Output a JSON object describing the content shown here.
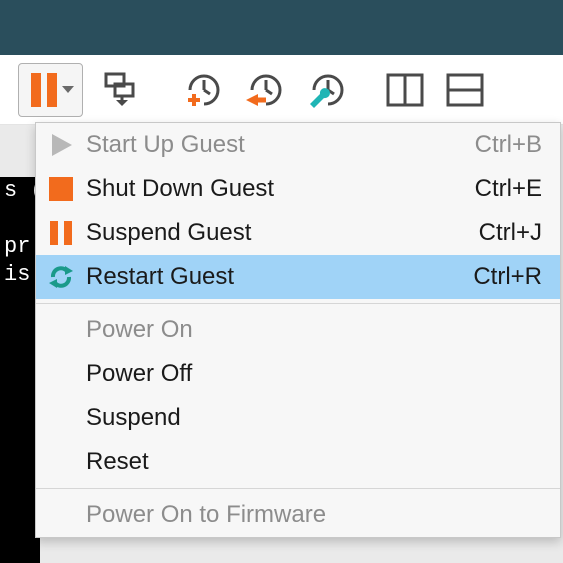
{
  "colors": {
    "accent_orange": "#f26b1d",
    "accent_teal": "#1fb5b5",
    "highlight": "#a0d3f7",
    "titlebar": "#2a4e5c"
  },
  "toolbar": {
    "buttons": [
      {
        "name": "pause-dropdown",
        "icon": "pause-icon"
      },
      {
        "name": "snapshot-button",
        "icon": "snapshot-icon"
      },
      {
        "name": "snapshot-add-button",
        "icon": "clock-add-icon"
      },
      {
        "name": "snapshot-revert-button",
        "icon": "clock-back-icon"
      },
      {
        "name": "snapshot-manage-button",
        "icon": "clock-wrench-icon"
      },
      {
        "name": "split-horizontal-button",
        "icon": "split-h-icon"
      },
      {
        "name": "split-vertical-button",
        "icon": "split-v-icon"
      }
    ]
  },
  "menu": {
    "items": [
      {
        "icon": "play-icon",
        "label": "Start Up Guest",
        "shortcut": "Ctrl+B",
        "enabled": false
      },
      {
        "icon": "stop-icon",
        "label": "Shut Down Guest",
        "shortcut": "Ctrl+E",
        "enabled": true
      },
      {
        "icon": "pause-icon",
        "label": "Suspend Guest",
        "shortcut": "Ctrl+J",
        "enabled": true
      },
      {
        "icon": "restart-icon",
        "label": "Restart Guest",
        "shortcut": "Ctrl+R",
        "enabled": true,
        "hover": true
      },
      {
        "separator": true
      },
      {
        "icon": "",
        "label": "Power On",
        "shortcut": "",
        "enabled": false
      },
      {
        "icon": "",
        "label": "Power Off",
        "shortcut": "",
        "enabled": true
      },
      {
        "icon": "",
        "label": "Suspend",
        "shortcut": "",
        "enabled": true
      },
      {
        "icon": "",
        "label": "Reset",
        "shortcut": "",
        "enabled": true
      },
      {
        "separator": true
      },
      {
        "icon": "",
        "label": "Power On to Firmware",
        "shortcut": "",
        "enabled": false
      }
    ]
  },
  "console_text": "s (\n\npr\nis"
}
